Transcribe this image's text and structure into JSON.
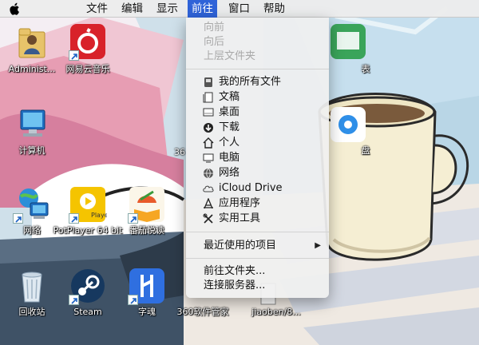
{
  "menubar": {
    "items": [
      {
        "label": "文件"
      },
      {
        "label": "编辑"
      },
      {
        "label": "显示"
      },
      {
        "label": "前往"
      },
      {
        "label": "窗口"
      },
      {
        "label": "帮助"
      }
    ],
    "active_index": 3,
    "accent_color": "#2f63d8"
  },
  "go_menu": {
    "items": [
      {
        "label": "向前",
        "enabled": false
      },
      {
        "label": "向后",
        "enabled": false
      },
      {
        "label": "上层文件夹",
        "enabled": false
      },
      {
        "label": "我的所有文件",
        "icon": "all-files-icon"
      },
      {
        "label": "文稿",
        "icon": "documents-icon"
      },
      {
        "label": "桌面",
        "icon": "desktop-icon"
      },
      {
        "label": "下载",
        "icon": "download-icon"
      },
      {
        "label": "个人",
        "icon": "home-icon"
      },
      {
        "label": "电脑",
        "icon": "computer-icon"
      },
      {
        "label": "网络",
        "icon": "network-icon"
      },
      {
        "label": "iCloud Drive",
        "icon": "cloud-icon"
      },
      {
        "label": "应用程序",
        "icon": "applications-icon"
      },
      {
        "label": "实用工具",
        "icon": "utilities-icon"
      },
      {
        "label": "最近使用的项目",
        "submenu": true
      },
      {
        "label": "前往文件夹..."
      },
      {
        "label": "连接服务器..."
      }
    ]
  },
  "desktop": {
    "icons": [
      {
        "label": "Administ...",
        "icon": "user-folder-icon"
      },
      {
        "label": "网易云音乐",
        "icon": "netease-music-icon"
      },
      {
        "label": "计算机",
        "icon": "computer-icon"
      },
      {
        "label": "网络",
        "icon": "network-icon"
      },
      {
        "label": "PotPlayer 64 bit",
        "icon": "potplayer-icon"
      },
      {
        "label": "番茄悦读",
        "icon": "reader-icon"
      },
      {
        "label": "回收站",
        "icon": "recycle-bin-icon"
      },
      {
        "label": "Steam",
        "icon": "steam-icon"
      },
      {
        "label": "字魂",
        "icon": "zihun-icon"
      },
      {
        "label": "360软件管家",
        "icon": "360-software-icon"
      },
      {
        "label": "jiaoben/8...",
        "icon": "file-icon"
      },
      {
        "label": "36",
        "icon": "360-icon"
      },
      {
        "label": "表",
        "icon": "app-icon"
      },
      {
        "label": "盘",
        "icon": "cloud-disk-icon"
      }
    ]
  }
}
